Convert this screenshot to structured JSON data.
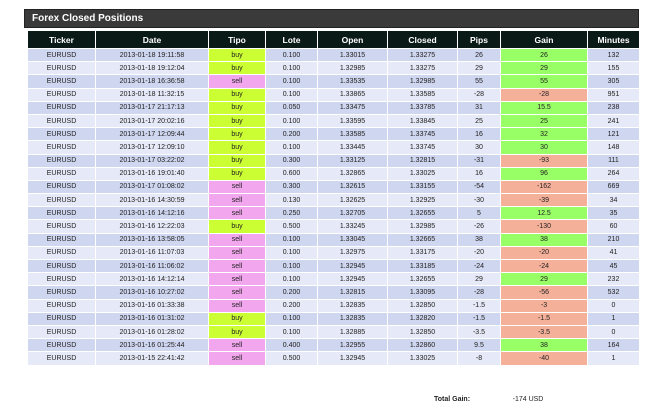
{
  "panel": {
    "title": "Forex Closed Positions"
  },
  "columns": [
    "Ticker",
    "Date",
    "Tipo",
    "Lote",
    "Open",
    "Closed",
    "Pips",
    "Gain",
    "Minutes"
  ],
  "rows": [
    [
      "EURUSD",
      "2013-01-18 19:11:58",
      "buy",
      "0.100",
      "1.33015",
      "1.33275",
      "26",
      "26",
      "132"
    ],
    [
      "EURUSD",
      "2013-01-18 19:12:04",
      "buy",
      "0.100",
      "1.32985",
      "1.33275",
      "29",
      "29",
      "155"
    ],
    [
      "EURUSD",
      "2013-01-18 16:36:58",
      "sell",
      "0.100",
      "1.33535",
      "1.32985",
      "55",
      "55",
      "305"
    ],
    [
      "EURUSD",
      "2013-01-18 11:32:15",
      "buy",
      "0.100",
      "1.33865",
      "1.33585",
      "-28",
      "-28",
      "951"
    ],
    [
      "EURUSD",
      "2013-01-17 21:17:13",
      "buy",
      "0.050",
      "1.33475",
      "1.33785",
      "31",
      "15.5",
      "238"
    ],
    [
      "EURUSD",
      "2013-01-17 20:02:16",
      "buy",
      "0.100",
      "1.33595",
      "1.33845",
      "25",
      "25",
      "241"
    ],
    [
      "EURUSD",
      "2013-01-17 12:09:44",
      "buy",
      "0.200",
      "1.33585",
      "1.33745",
      "16",
      "32",
      "121"
    ],
    [
      "EURUSD",
      "2013-01-17 12:09:10",
      "buy",
      "0.100",
      "1.33445",
      "1.33745",
      "30",
      "30",
      "148"
    ],
    [
      "EURUSD",
      "2013-01-17 03:22:02",
      "buy",
      "0.300",
      "1.33125",
      "1.32815",
      "-31",
      "-93",
      "111"
    ],
    [
      "EURUSD",
      "2013-01-16 19:01:40",
      "buy",
      "0.600",
      "1.32865",
      "1.33025",
      "16",
      "96",
      "264"
    ],
    [
      "EURUSD",
      "2013-01-17 01:08:02",
      "sell",
      "0.300",
      "1.32615",
      "1.33155",
      "-54",
      "-162",
      "669"
    ],
    [
      "EURUSD",
      "2013-01-16 14:30:59",
      "sell",
      "0.130",
      "1.32625",
      "1.32925",
      "-30",
      "-39",
      "34"
    ],
    [
      "EURUSD",
      "2013-01-16 14:12:16",
      "sell",
      "0.250",
      "1.32705",
      "1.32655",
      "5",
      "12.5",
      "35"
    ],
    [
      "EURUSD",
      "2013-01-16 12:22:03",
      "buy",
      "0.500",
      "1.33245",
      "1.32985",
      "-26",
      "-130",
      "60"
    ],
    [
      "EURUSD",
      "2013-01-16 13:58:05",
      "sell",
      "0.100",
      "1.33045",
      "1.32665",
      "38",
      "38",
      "210"
    ],
    [
      "EURUSD",
      "2013-01-16 11:07:03",
      "sell",
      "0.100",
      "1.32975",
      "1.33175",
      "-20",
      "-20",
      "41"
    ],
    [
      "EURUSD",
      "2013-01-16 11:06:02",
      "sell",
      "0.100",
      "1.32945",
      "1.33185",
      "-24",
      "-24",
      "45"
    ],
    [
      "EURUSD",
      "2013-01-16 14:12:14",
      "sell",
      "0.100",
      "1.32945",
      "1.32655",
      "29",
      "29",
      "232"
    ],
    [
      "EURUSD",
      "2013-01-16 10:27:02",
      "sell",
      "0.200",
      "1.32815",
      "1.33095",
      "-28",
      "-56",
      "532"
    ],
    [
      "EURUSD",
      "2013-01-16 01:33:38",
      "sell",
      "0.200",
      "1.32835",
      "1.32850",
      "-1.5",
      "-3",
      "0"
    ],
    [
      "EURUSD",
      "2013-01-16 01:31:02",
      "buy",
      "0.100",
      "1.32835",
      "1.32820",
      "-1.5",
      "-1.5",
      "1"
    ],
    [
      "EURUSD",
      "2013-01-16 01:28:02",
      "buy",
      "0.100",
      "1.32885",
      "1.32850",
      "-3.5",
      "-3.5",
      "0"
    ],
    [
      "EURUSD",
      "2013-01-16 01:25:44",
      "sell",
      "0.400",
      "1.32955",
      "1.32860",
      "9.5",
      "38",
      "164"
    ],
    [
      "EURUSD",
      "2013-01-15 22:41:42",
      "sell",
      "0.500",
      "1.32945",
      "1.33025",
      "-8",
      "-40",
      "1"
    ]
  ],
  "totals": {
    "label": "Total Gain:",
    "value": "-174 USD"
  },
  "colors": {
    "header_bg": "#0a1a16",
    "buy": "#ccff33",
    "sell": "#f2a6ee",
    "gain_positive": "#99ff66",
    "gain_negative": "#f5b09a"
  }
}
